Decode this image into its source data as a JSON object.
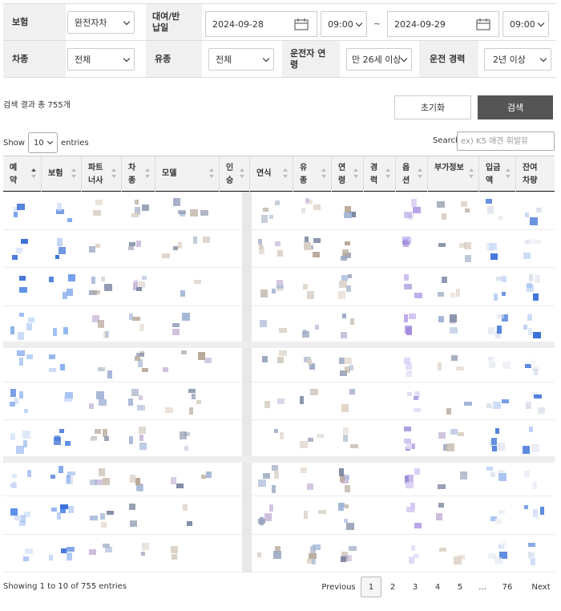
{
  "filters": {
    "insurance": {
      "label": "보험",
      "value": "완전자차"
    },
    "rental_period": {
      "label": "대여/반납일",
      "start_date": "2024-09-28",
      "start_time": "09:00",
      "separator": "~",
      "end_date": "2024-09-29",
      "end_time": "09:00"
    },
    "car_type": {
      "label": "차종",
      "value": "전체"
    },
    "fuel_type": {
      "label": "유종",
      "value": "전체"
    },
    "driver_age": {
      "label": "운전자 연령",
      "value": "만 26세 이상"
    },
    "driving_experience": {
      "label": "운전 경력",
      "value": "2년 이상"
    }
  },
  "results": {
    "summary": "검색 결과 총 755개"
  },
  "actions": {
    "reset_label": "초기화",
    "search_label": "검색"
  },
  "table_controls": {
    "show_label": "Show",
    "entries_value": "10",
    "entries_label": "entries",
    "search_label": "Search:",
    "search_placeholder": "ex) K5 애견 휘발유"
  },
  "table": {
    "columns": [
      "예약",
      "보험",
      "파트너사",
      "차종",
      "모델",
      "인승",
      "연식",
      "유종",
      "연령",
      "경력",
      "옵션",
      "부가정보",
      "입금액",
      "잔여차량"
    ]
  },
  "footer": {
    "info": "Showing 1 to 10 of 755 entries",
    "pagination": [
      "Previous",
      "1",
      "2",
      "3",
      "4",
      "5",
      "...",
      "76",
      "Next"
    ],
    "current_page": "1"
  },
  "colors": {
    "label_bg": "#f0f0f0",
    "search_button_bg": "#555555",
    "link_blue": "#2a6fd6"
  }
}
